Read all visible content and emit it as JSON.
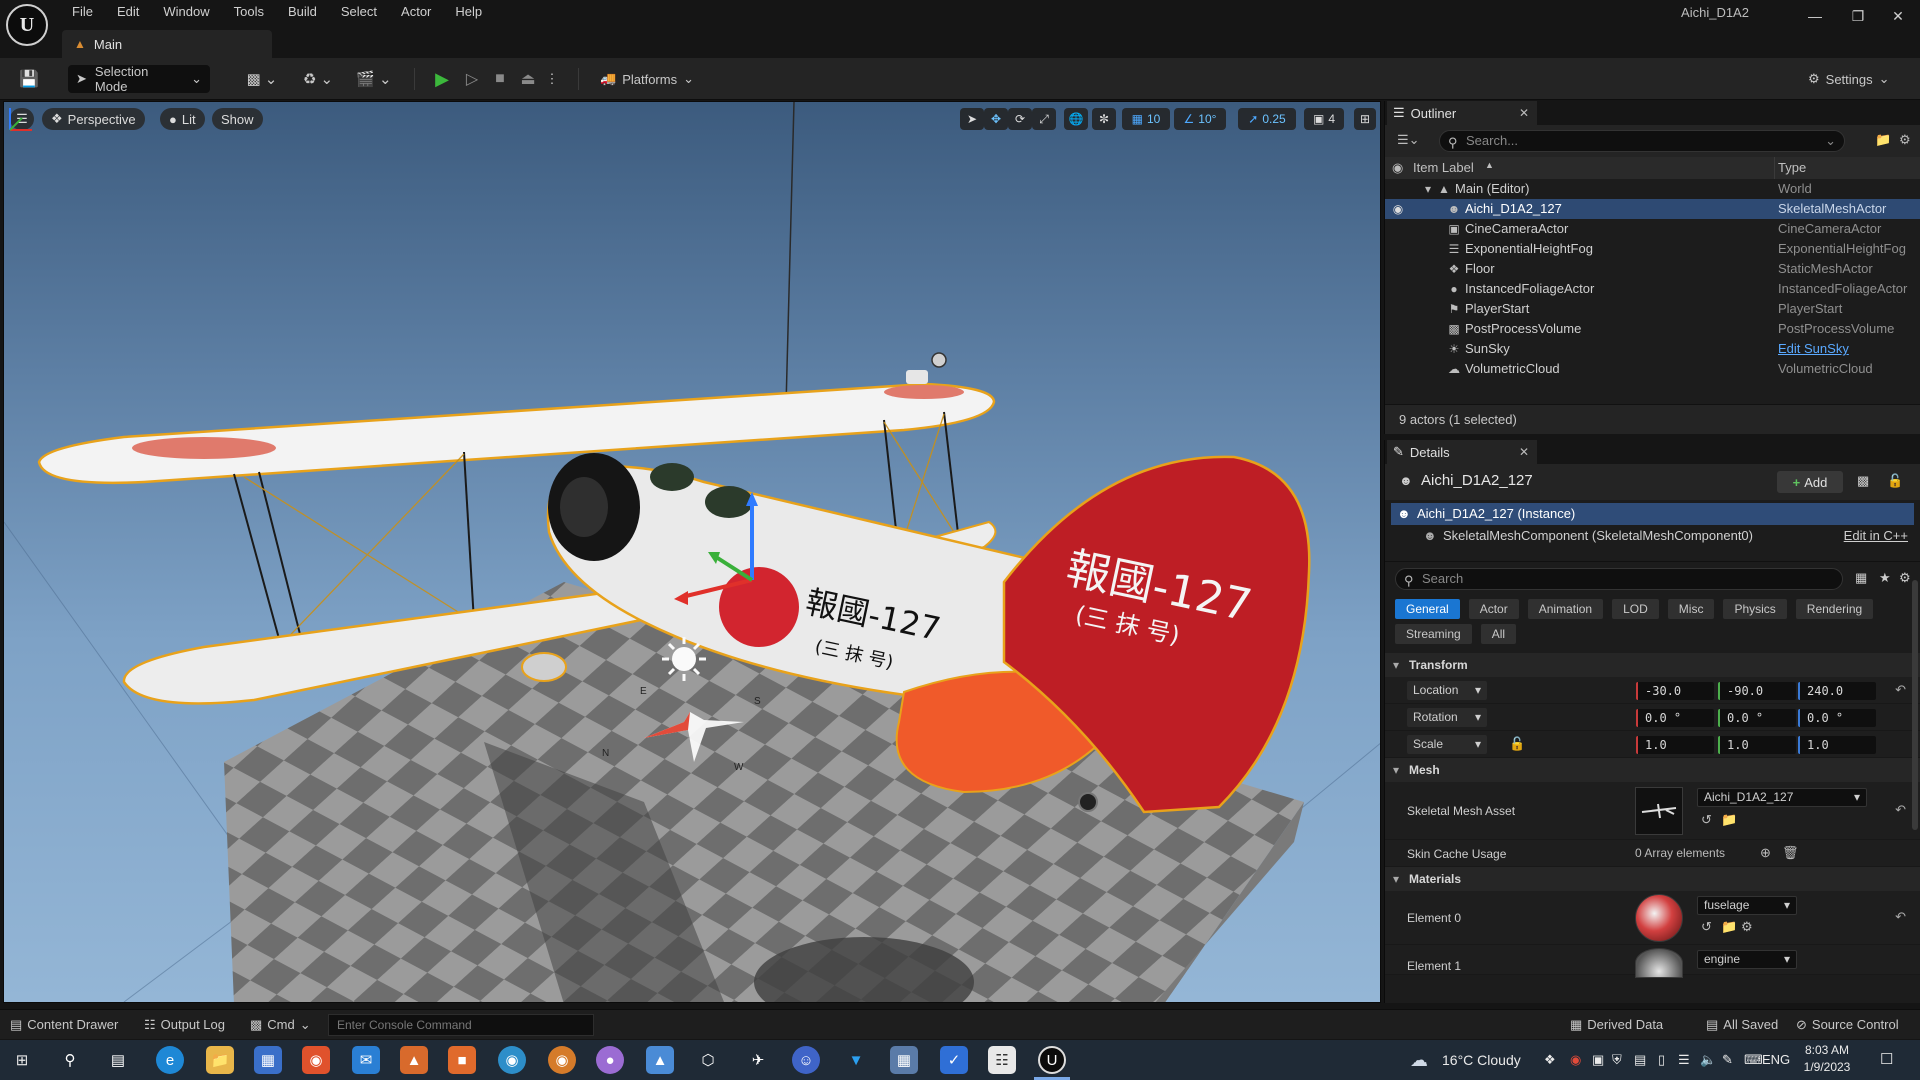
{
  "app": {
    "title": "Aichi_D1A2",
    "logo_letter": "U",
    "menu": [
      "File",
      "Edit",
      "Window",
      "Tools",
      "Build",
      "Select",
      "Actor",
      "Help"
    ],
    "doc_tab": "Main"
  },
  "toolbar": {
    "selection_mode": "Selection Mode",
    "platforms": "Platforms",
    "settings": "Settings"
  },
  "viewport": {
    "menu_icon": "hamburger-icon",
    "perspective": "Perspective",
    "lit": "Lit",
    "show": "Show",
    "grid_snap": "10",
    "rotation_snap": "10°",
    "scale_snap": "0.25",
    "camera_speed": "4",
    "plane_marking_fuselage": "報國-127",
    "plane_marking_fuselage_sub": "(三 抹 号)",
    "plane_marking_tail": "報國-127",
    "plane_marking_tail_sub": "(三 抹 号)",
    "compass_letters": [
      "E",
      "S",
      "N",
      "W"
    ],
    "sky_color": "#6d92b8",
    "hinomaru_color": "#d2252f"
  },
  "outliner": {
    "tab": "Outliner",
    "search_placeholder": "Search...",
    "col_label": "Item Label",
    "col_type": "Type",
    "root": {
      "label": "Main (Editor)",
      "type": "World"
    },
    "items": [
      {
        "label": "Aichi_D1A2_127",
        "type": "SkeletalMeshActor",
        "icon": "skeletal-mesh-icon"
      },
      {
        "label": "CineCameraActor",
        "type": "CineCameraActor",
        "icon": "camera-icon"
      },
      {
        "label": "ExponentialHeightFog",
        "type": "ExponentialHeightFog",
        "icon": "fog-icon"
      },
      {
        "label": "Floor",
        "type": "StaticMeshActor",
        "icon": "static-mesh-icon"
      },
      {
        "label": "InstancedFoliageActor",
        "type": "InstancedFoliageActor",
        "icon": "foliage-icon"
      },
      {
        "label": "PlayerStart",
        "type": "PlayerStart",
        "icon": "player-start-icon"
      },
      {
        "label": "PostProcessVolume",
        "type": "PostProcessVolume",
        "icon": "volume-icon"
      },
      {
        "label": "SunSky",
        "type": "Edit SunSky",
        "icon": "sun-icon"
      },
      {
        "label": "VolumetricCloud",
        "type": "VolumetricCloud",
        "icon": "cloud-icon"
      }
    ],
    "footer": "9 actors (1 selected)"
  },
  "details": {
    "tab": "Details",
    "actor_name": "Aichi_D1A2_127",
    "add_label": "Add",
    "component_root": "Aichi_D1A2_127 (Instance)",
    "component_child": "SkeletalMeshComponent (SkeletalMeshComponent0)",
    "edit_cpp": "Edit in C++",
    "search_placeholder": "Search",
    "filter_tabs": [
      "General",
      "Actor",
      "Animation",
      "LOD",
      "Misc",
      "Physics",
      "Rendering",
      "Streaming",
      "All"
    ],
    "transform": {
      "header": "Transform",
      "location_label": "Location",
      "location": [
        "-30.0",
        "-90.0",
        "240.0"
      ],
      "rotation_label": "Rotation",
      "rotation": [
        "0.0 °",
        "0.0 °",
        "0.0 °"
      ],
      "scale_label": "Scale",
      "scale": [
        "1.0",
        "1.0",
        "1.0"
      ]
    },
    "mesh": {
      "header": "Mesh",
      "skeletal_mesh_label": "Skeletal Mesh Asset",
      "skeletal_mesh_value": "Aichi_D1A2_127",
      "skin_cache_label": "Skin Cache Usage",
      "skin_cache_value": "0 Array elements"
    },
    "materials": {
      "header": "Materials",
      "element0_label": "Element 0",
      "element0_value": "fuselage",
      "element1_label": "Element 1",
      "element1_value": "engine"
    }
  },
  "statusbar": {
    "content_drawer": "Content Drawer",
    "output_log": "Output Log",
    "cmd": "Cmd",
    "console_placeholder": "Enter Console Command",
    "derived_data": "Derived Data",
    "all_saved": "All Saved",
    "source_control": "Source Control"
  },
  "taskbar": {
    "weather": "16°C  Cloudy",
    "language": "ENG",
    "time": "8:03 AM",
    "date": "1/9/2023"
  }
}
